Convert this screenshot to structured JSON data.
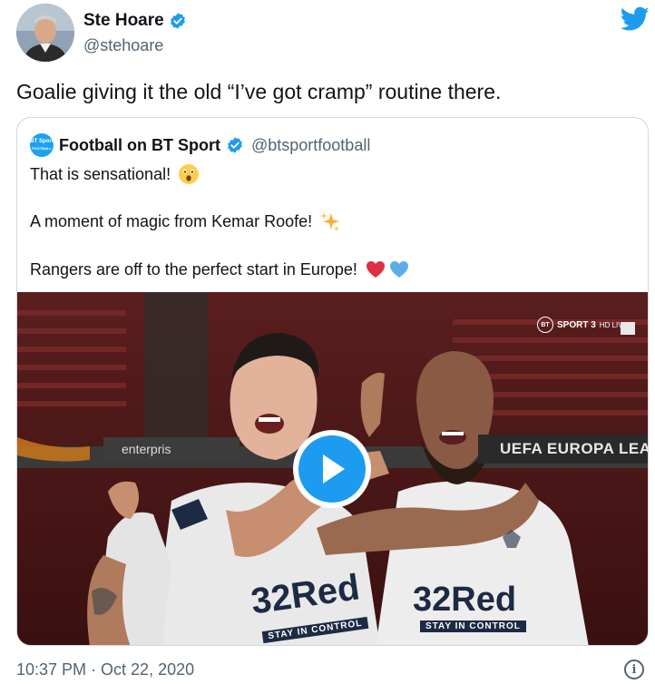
{
  "author": {
    "display_name": "Ste Hoare",
    "handle": "@stehoare",
    "verified": true
  },
  "tweet": {
    "text": "Goalie giving it the old “I’ve got cramp” routine there.",
    "timestamp": "10:37 PM · Oct 22, 2020"
  },
  "quoted_tweet": {
    "display_name": "Football on BT Sport",
    "handle": "@btsportfootball",
    "verified": true,
    "avatar_text_top": "BT Sport",
    "avatar_text_bottom": "FOOTBALL",
    "lines": [
      {
        "text": "That is sensational!",
        "emoji": "astonished-face-emoji"
      },
      {
        "text": "A moment of magic from Kemar Roofe!",
        "emoji": "sparkles-emoji"
      },
      {
        "text": "Rangers are off to the perfect start in Europe!",
        "emoji": "red-heart-and-blue-heart-emoji"
      }
    ],
    "video": {
      "watermark_bt": "BT",
      "watermark_channel": "SPORT 3",
      "watermark_live": "HD LIVE",
      "banner_right": "UEFA EUROPA LEAG",
      "banner_left": "enterpris",
      "sponsor_left": "32Red",
      "sponsor_left_sub": "STAY IN CONTROL",
      "sponsor_right": "32Red",
      "sponsor_right_sub": "STAY IN CONTROL",
      "play_icon": "play-icon"
    }
  },
  "colors": {
    "twitter_blue": "#1d9bf0",
    "text_primary": "#0f1419",
    "text_secondary": "#536471",
    "border": "#cfd9de",
    "heart_red": "#e0245e",
    "heart_blue": "#5dadec"
  },
  "icons": {
    "brand": "twitter-bird-icon",
    "verified": "verified-badge-icon",
    "info": "info-icon"
  }
}
